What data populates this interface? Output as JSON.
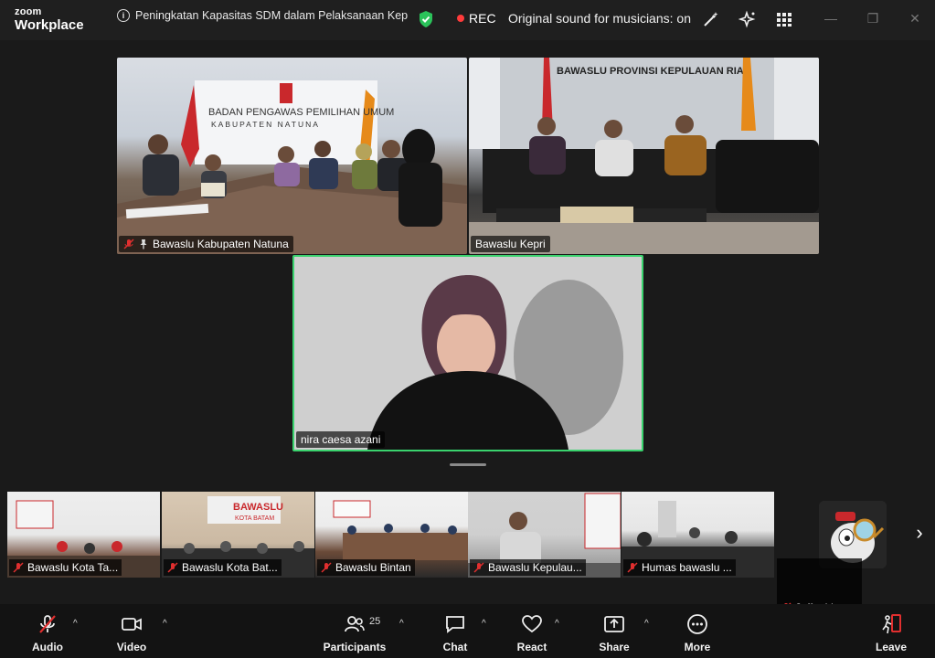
{
  "app": {
    "brand_top": "zoom",
    "brand_bottom": "Workplace"
  },
  "meeting": {
    "title": "Peningkatan Kapasitas SDM dalam Pelaksanaan Kep",
    "rec_label": "REC",
    "sound_status": "Original sound for musicians: on"
  },
  "tiles": [
    {
      "name": "Bawaslu Kabupaten Natuna",
      "banner_line1": "BADAN PENGAWAS PEMILIHAN UMUM",
      "banner_line2": "KABUPATEN NATUNA"
    },
    {
      "name": "Bawaslu Kepri",
      "banner_line1": "BAWASLU PROVINSI KEPULAUAN RIAU"
    },
    {
      "name": "nira caesa azani"
    }
  ],
  "strip": [
    {
      "name": "Bawaslu Kota Ta..."
    },
    {
      "name": "Bawaslu Kota Bat...",
      "sign_line1": "BAWASLU",
      "sign_line2": "KOTA BATAM"
    },
    {
      "name": "Bawaslu Bintan"
    },
    {
      "name": "Bawaslu Kepulau..."
    },
    {
      "name": "Humas bawaslu ..."
    },
    {
      "name": "Jeffry Lingga"
    }
  ],
  "toolbar": {
    "audio": "Audio",
    "video": "Video",
    "participants": "Participants",
    "participants_count": "25",
    "chat": "Chat",
    "react": "React",
    "share": "Share",
    "more": "More",
    "leave": "Leave"
  },
  "colors": {
    "active_speaker": "#3ad36e",
    "rec": "#ff3b3b",
    "mute": "#e02f2f",
    "leave": "#e02f2f"
  }
}
